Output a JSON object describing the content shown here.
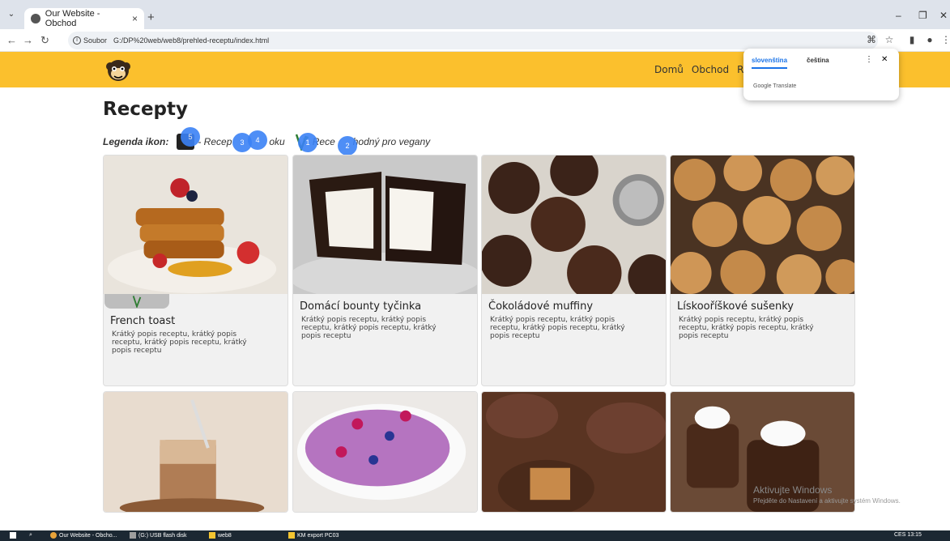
{
  "browser": {
    "tab_title": "Our Website - Obchod",
    "url_prefix": "Soubor",
    "url": "G:/DP%20web/web8/prehled-receptu/index.html"
  },
  "site": {
    "nav": [
      "Domů",
      "Obchod",
      "Re"
    ]
  },
  "translate_popup": {
    "lang_active": "slovenština",
    "lang_other": "čeština",
    "brand": "Google Translate"
  },
  "page": {
    "title": "Recepty",
    "legend_label": "Legenda ikon:",
    "legend_item1": "- Recep",
    "legend_item1b": "oku",
    "legend_item2": "Rece",
    "legend_item2b": "hodný pro vegany"
  },
  "badges": [
    "5",
    "3",
    "4",
    "1",
    "2"
  ],
  "recipes": [
    {
      "name": "French toast",
      "desc": "Krátký popis receptu, krátký popis receptu, krátký popis receptu, krátký popis receptu",
      "vegan": true
    },
    {
      "name": "Domácí bounty tyčinka",
      "desc": "Krátký popis receptu, krátký popis receptu, krátký popis receptu, krátký popis receptu",
      "vegan": false
    },
    {
      "name": "Čokoládové muffiny",
      "desc": "Krátký popis receptu, krátký popis receptu, krátký popis receptu, krátký popis receptu",
      "vegan": false
    },
    {
      "name": "Lískooříškové sušenky",
      "desc": "Krátký popis receptu, krátký popis receptu, krátký popis receptu, krátký popis receptu",
      "vegan": false
    }
  ],
  "windows": {
    "watermark": "Aktivujte Windows",
    "watermark_sub": "Přejděte do Nastavení a aktivujte systém Windows.",
    "taskbar_items": [
      "Our Website - Obcho...",
      "(G:) USB flash disk",
      "web8",
      "KM export PC03"
    ],
    "tray": "CES  13:15"
  },
  "colors": {
    "header": "#fbc02d",
    "badge": "#3b82f6",
    "card_bg": "#f1f1f1"
  }
}
